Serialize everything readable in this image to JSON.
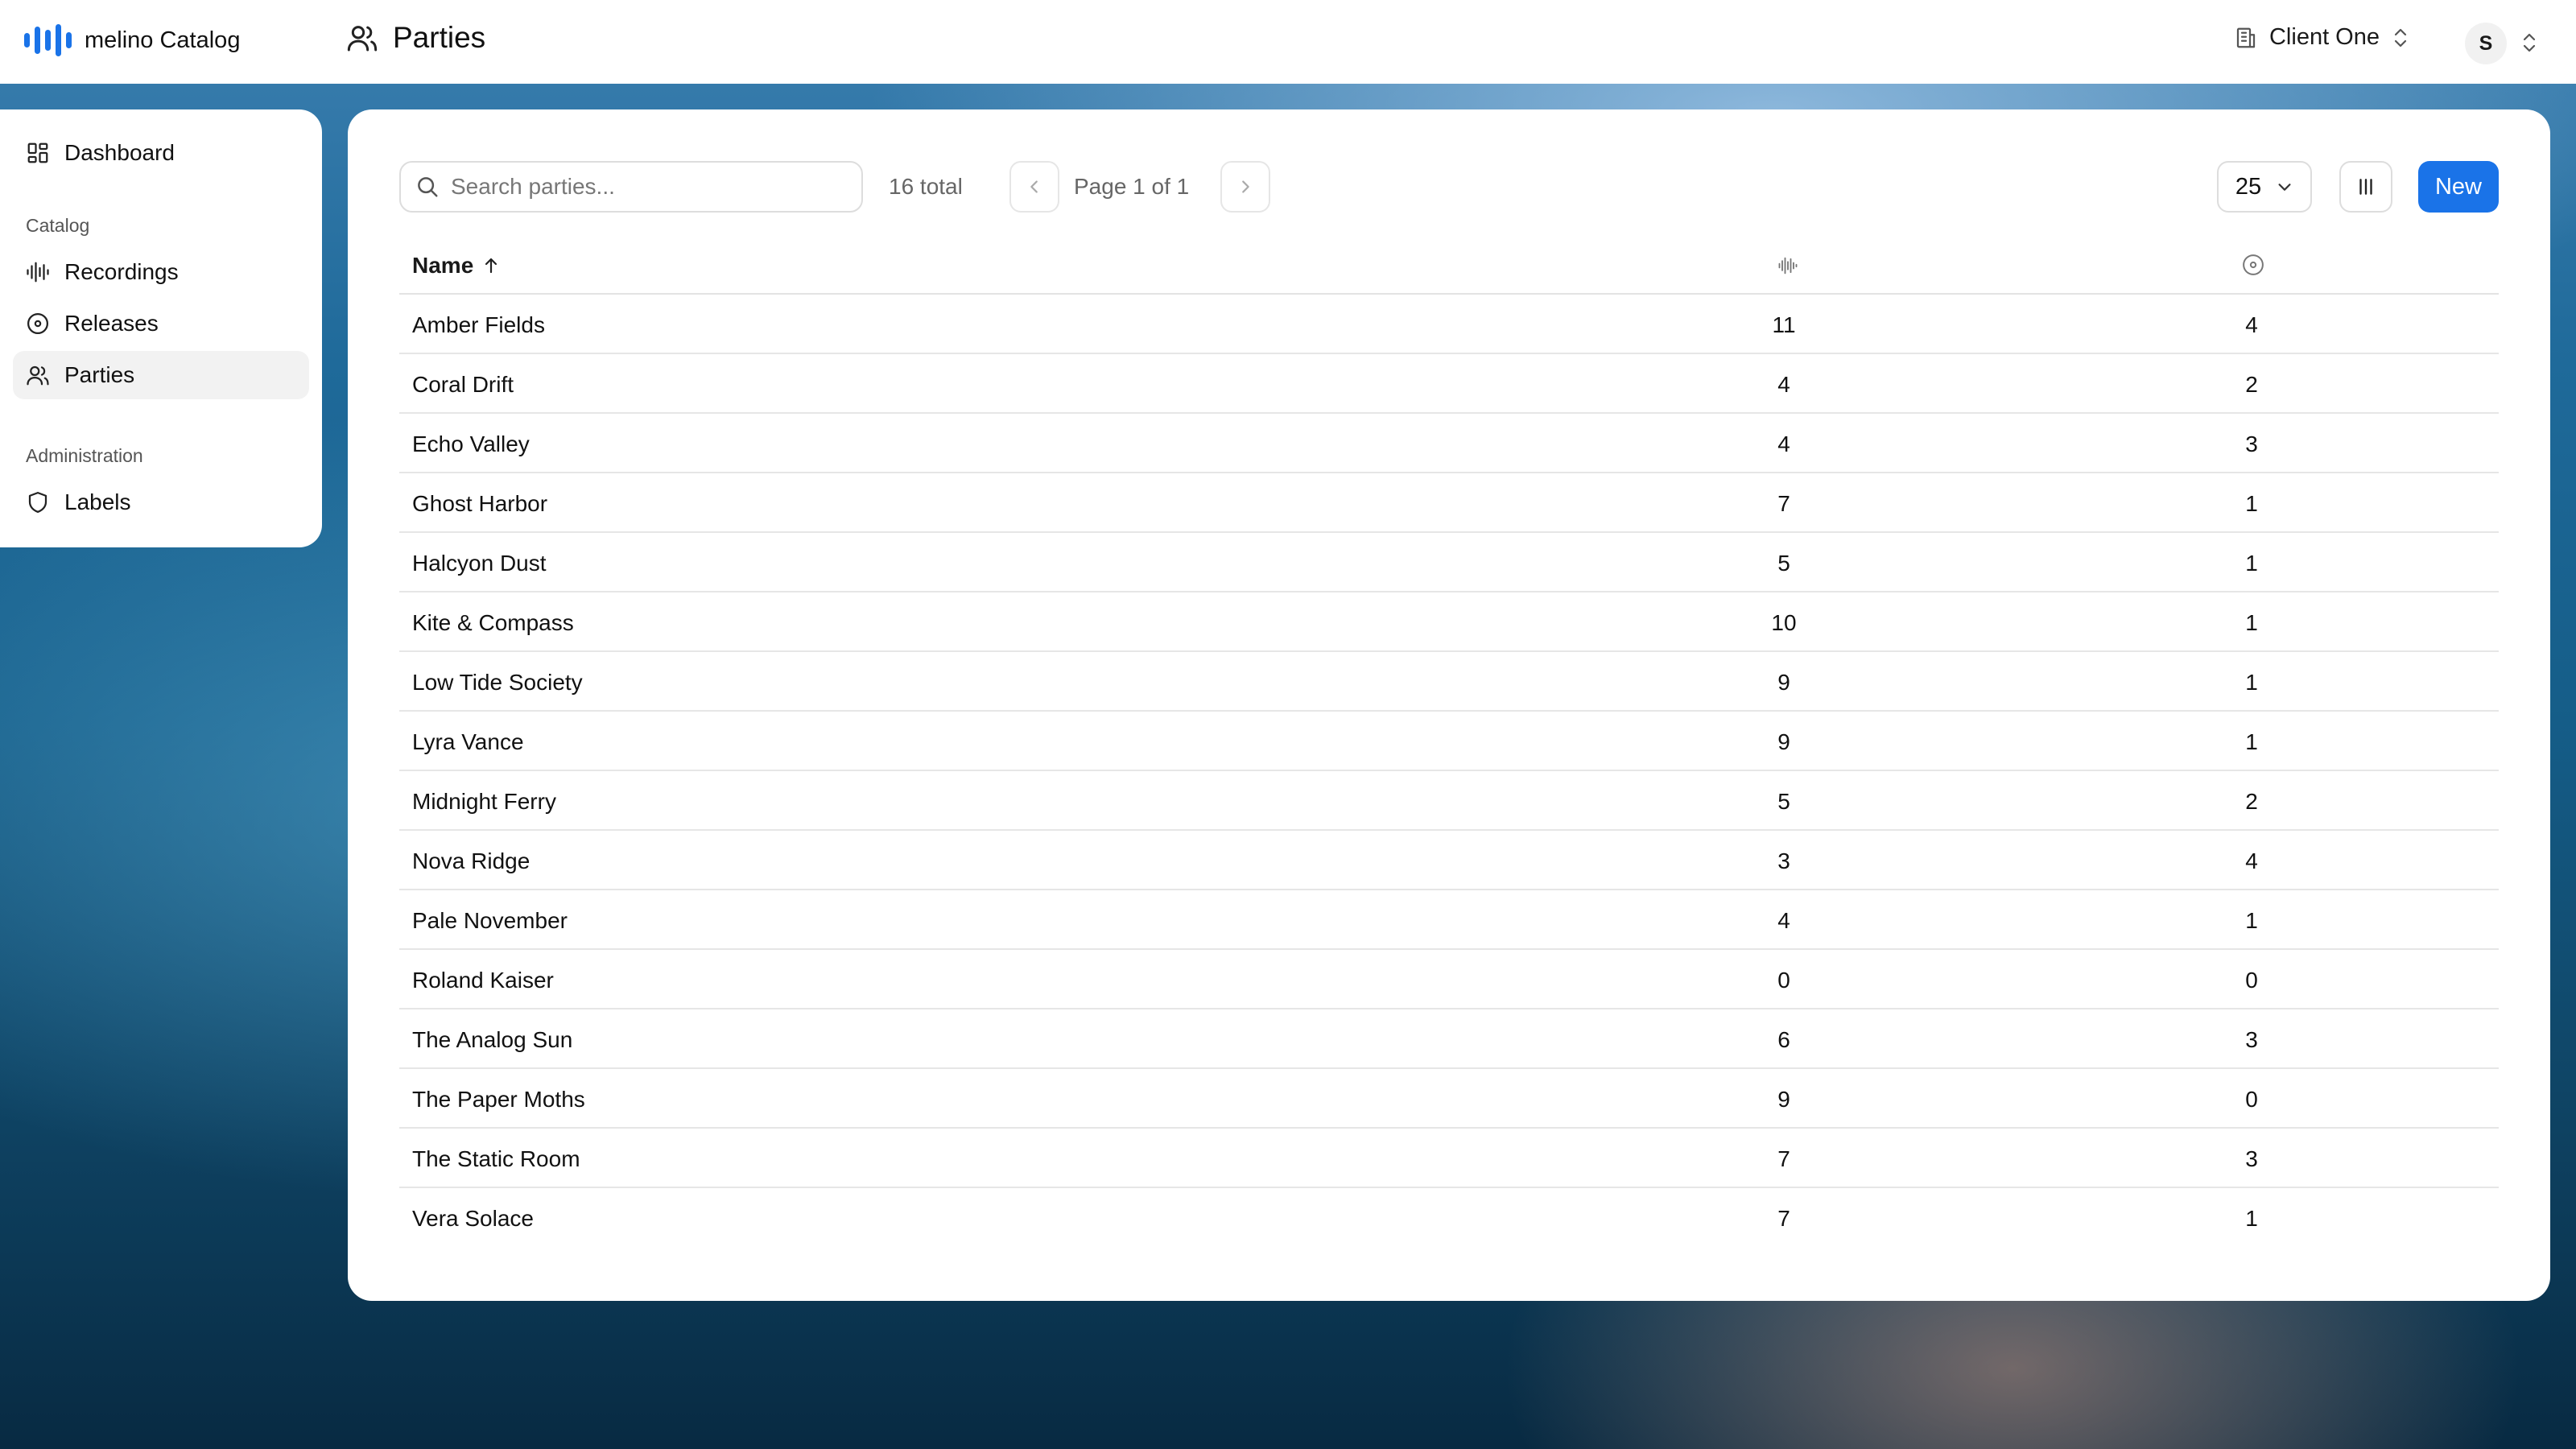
{
  "app": {
    "brand": "melino Catalog",
    "page_title": "Parties"
  },
  "header": {
    "client": "Client One",
    "user_initial": "S"
  },
  "sidebar": {
    "dashboard": "Dashboard",
    "catalog_heading": "Catalog",
    "recordings": "Recordings",
    "releases": "Releases",
    "parties": "Parties",
    "admin_heading": "Administration",
    "labels": "Labels"
  },
  "toolbar": {
    "search_placeholder": "Search parties...",
    "total": "16 total",
    "page": "Page 1 of 1",
    "page_size": "25",
    "new_label": "New"
  },
  "table": {
    "name_header": "Name",
    "rows": [
      {
        "name": "Amber Fields",
        "recordings": "11",
        "releases": "4"
      },
      {
        "name": "Coral Drift",
        "recordings": "4",
        "releases": "2"
      },
      {
        "name": "Echo Valley",
        "recordings": "4",
        "releases": "3"
      },
      {
        "name": "Ghost Harbor",
        "recordings": "7",
        "releases": "1"
      },
      {
        "name": "Halcyon Dust",
        "recordings": "5",
        "releases": "1"
      },
      {
        "name": "Kite & Compass",
        "recordings": "10",
        "releases": "1"
      },
      {
        "name": "Low Tide Society",
        "recordings": "9",
        "releases": "1"
      },
      {
        "name": "Lyra Vance",
        "recordings": "9",
        "releases": "1"
      },
      {
        "name": "Midnight Ferry",
        "recordings": "5",
        "releases": "2"
      },
      {
        "name": "Nova Ridge",
        "recordings": "3",
        "releases": "4"
      },
      {
        "name": "Pale November",
        "recordings": "4",
        "releases": "1"
      },
      {
        "name": "Roland Kaiser",
        "recordings": "0",
        "releases": "0"
      },
      {
        "name": "The Analog Sun",
        "recordings": "6",
        "releases": "3"
      },
      {
        "name": "The Paper Moths",
        "recordings": "9",
        "releases": "0"
      },
      {
        "name": "The Static Room",
        "recordings": "7",
        "releases": "3"
      },
      {
        "name": "Vera Solace",
        "recordings": "7",
        "releases": "1"
      }
    ]
  },
  "colors": {
    "accent": "#1a73e8"
  },
  "icons": {
    "brand": "bars-logo-icon",
    "parties": "users-icon",
    "dashboard": "grid-icon",
    "recordings": "waveform-icon",
    "releases": "disc-icon",
    "labels": "shield-icon",
    "client": "building-icon",
    "search": "search-icon",
    "columns": "columns-icon"
  }
}
